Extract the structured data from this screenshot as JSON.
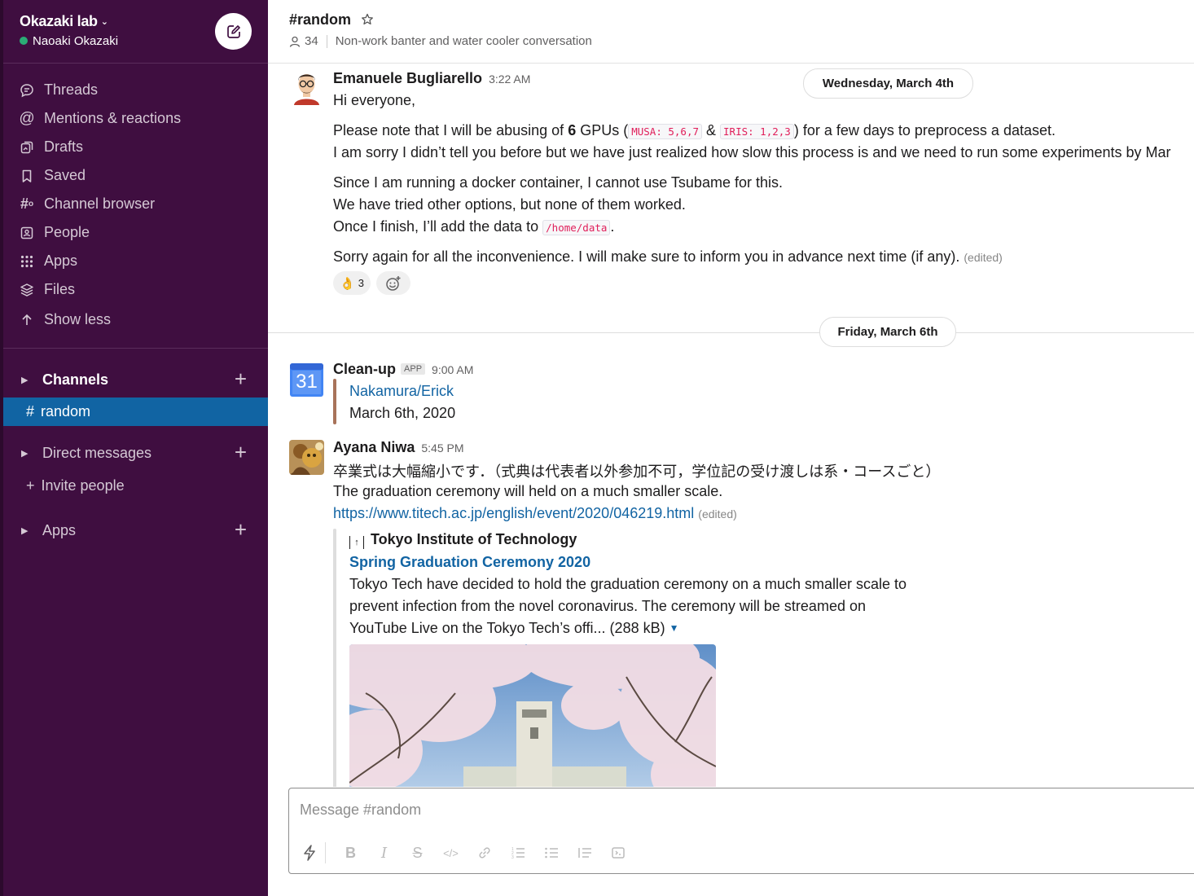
{
  "workspace": {
    "name": "Okazaki lab",
    "user": "Naoaki Okazaki"
  },
  "nav": [
    {
      "label": "Threads",
      "icon": "threads-icon"
    },
    {
      "label": "Mentions & reactions",
      "icon": "at-icon"
    },
    {
      "label": "Drafts",
      "icon": "drafts-icon"
    },
    {
      "label": "Saved",
      "icon": "bookmark-icon"
    },
    {
      "label": "Channel browser",
      "icon": "channel-browser-icon"
    },
    {
      "label": "People",
      "icon": "people-icon"
    },
    {
      "label": "Apps",
      "icon": "apps-icon"
    },
    {
      "label": "Files",
      "icon": "files-icon"
    },
    {
      "label": "Show less",
      "icon": "arrow-up-icon"
    }
  ],
  "sections": {
    "channels": "Channels",
    "active_channel_hash": "#",
    "active_channel": "random",
    "direct_messages": "Direct messages",
    "invite": "Invite people",
    "apps": "Apps"
  },
  "channel": {
    "title": "#random",
    "member_count": "34",
    "topic": "Non-work banter and water cooler conversation"
  },
  "dates": {
    "d1": "Wednesday, March 4th",
    "d2": "Friday, March 6th"
  },
  "messages": {
    "m1": {
      "author": "Emanuele Bugliarello",
      "time": "3:22 AM",
      "l1": "Hi everyone,",
      "l2a": "Please note that I will be abusing of ",
      "l2b": "6",
      "l2c": " GPUs (",
      "l2code1": "MUSA: 5,6,7",
      "l2d": " & ",
      "l2code2": "IRIS: 1,2,3",
      "l2e": ") for a few days to preprocess a dataset.",
      "l3": "I am sorry I didn’t tell you before but we have just realized how slow this process is and we need to run some experiments by Mar",
      "l4": "Since I am running a docker container, I cannot use Tsubame for this.",
      "l5": "We have tried other options, but none of them worked.",
      "l6a": "Once I finish, I’ll add the data to ",
      "l6code": "/home/data",
      "l6b": ".",
      "l7": "Sorry again for all the inconvenience. I will make sure to inform you in advance next time (if any).",
      "edited": "(edited)",
      "reaction_emoji": "👌",
      "reaction_count": "3"
    },
    "m2": {
      "author": "Clean-up",
      "badge": "APP",
      "time": "9:00 AM",
      "calendar_day": "31",
      "title": "Nakamura/Erick",
      "date": "March 6th, 2020"
    },
    "m3": {
      "author": "Ayana Niwa",
      "time": "5:45 PM",
      "l1": "卒業式は大幅縮小です．（式典は代表者以外参加不可，学位記の受け渡しは系・コースごと）",
      "l2": "The graduation ceremony will held on a much smaller scale.",
      "url": "https://www.titech.ac.jp/english/event/2020/046219.html",
      "edited": "(edited)",
      "site": "Tokyo Institute of Technology",
      "preview_title": "Spring Graduation Ceremony 2020",
      "p1": "Tokyo Tech have decided to hold the graduation ceremony on a much smaller scale to",
      "p2": "prevent infection from the novel coronavirus. The ceremony will be streamed on",
      "p3": "YouTube Live on the Tokyo Tech’s offi... (288 kB)"
    }
  },
  "composer": {
    "placeholder": "Message #random"
  },
  "colors": {
    "sidebar": "#3f0e40",
    "active": "#1164a3",
    "link": "#1264a3",
    "code": "#e01e5a"
  }
}
